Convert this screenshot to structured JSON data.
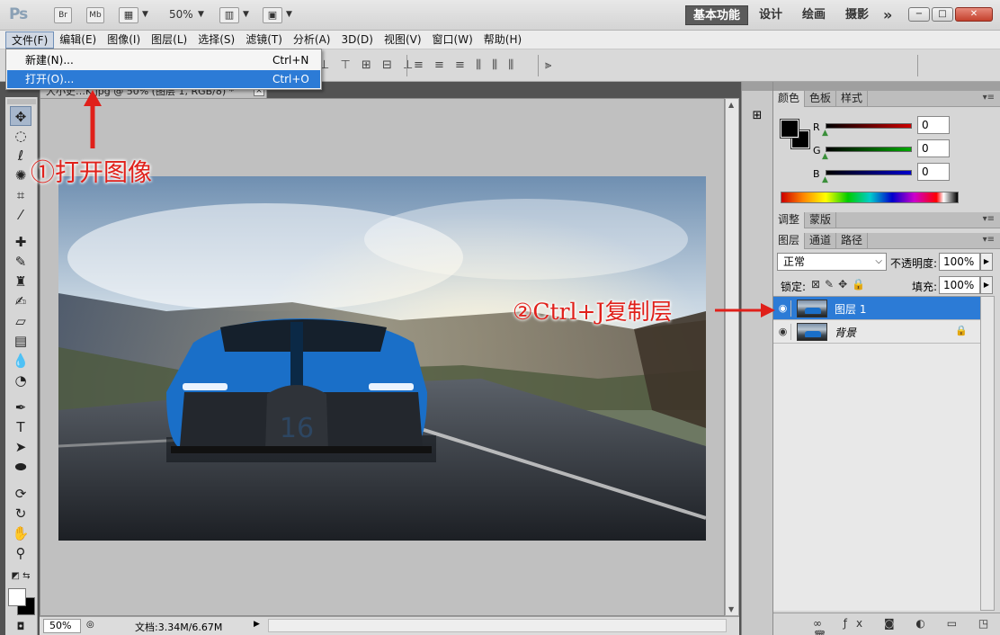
{
  "titlebar": {
    "app_logo": "Ps",
    "bridge_label": "Br",
    "minibridge_label": "Mb",
    "zoom": "50%",
    "workspaces": [
      "基本功能",
      "设计",
      "绘画",
      "摄影"
    ],
    "more": "»",
    "window_controls": [
      "−",
      "□",
      "✕"
    ]
  },
  "menubar": {
    "items": [
      "文件(F)",
      "编辑(E)",
      "图像(I)",
      "图层(L)",
      "选择(S)",
      "滤镜(T)",
      "分析(A)",
      "3D(D)",
      "视图(V)",
      "窗口(W)",
      "帮助(H)"
    ]
  },
  "file_menu": {
    "items": [
      {
        "label": "新建(N)...",
        "shortcut": "Ctrl+N"
      },
      {
        "label": "打开(O)...",
        "shortcut": "Ctrl+O"
      }
    ]
  },
  "document": {
    "tab_title": "大小史…K.jpg @ 50% (图层 1, RGB/8) *",
    "close": "×"
  },
  "statusbar": {
    "zoom": "50%",
    "doc_info": "文档:3.34M/6.67M"
  },
  "panels": {
    "color_tabs": [
      "颜色",
      "色板",
      "样式"
    ],
    "rgb": [
      {
        "label": "R",
        "value": "0",
        "color": "#cc0000"
      },
      {
        "label": "G",
        "value": "0",
        "color": "#00aa00"
      },
      {
        "label": "B",
        "value": "0",
        "color": "#0000cc"
      }
    ],
    "adjust_tabs": [
      "调整",
      "蒙版"
    ],
    "layer_tabs": [
      "图层",
      "通道",
      "路径"
    ],
    "blend_mode": "正常",
    "opacity_label": "不透明度:",
    "opacity": "100%",
    "lock_label": "锁定:",
    "fill_label": "填充:",
    "fill": "100%",
    "layers": [
      {
        "name": "图层 1",
        "selected": true
      },
      {
        "name": "背景",
        "selected": false
      }
    ]
  },
  "annotations": {
    "step1": "①打开图像",
    "step2": "②Ctrl+J复制层"
  },
  "colors": {
    "selection_blue": "#2c7bd6",
    "annotation_red": "#e0201a"
  }
}
